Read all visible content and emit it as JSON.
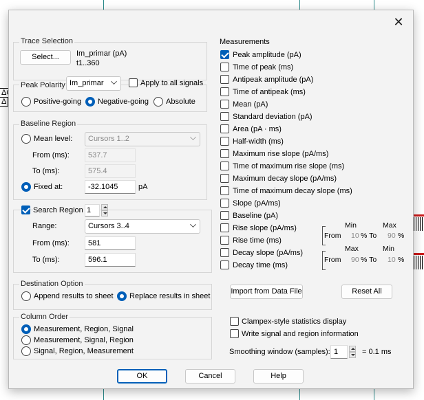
{
  "background": {
    "frag1": "ΔC",
    "frag2": "Δ"
  },
  "dialog": {
    "close_glyph": "✕",
    "trace_selection": {
      "title": "Trace Selection",
      "select_button": "Select...",
      "signal_name": "Im_primar (pA)",
      "trace_range": "t1..360"
    },
    "peak_polarity": {
      "title": "Peak Polarity",
      "signal_value": "Im_primar",
      "apply_all_label": "Apply to all signals",
      "apply_all_checked": false,
      "options": [
        "Positive-going",
        "Negative-going",
        "Absolute"
      ],
      "selected": "Negative-going"
    },
    "baseline_region": {
      "title": "Baseline Region",
      "mean_level_label": "Mean level:",
      "mean_level_value": "Cursors 1..2",
      "from_label": "From (ms):",
      "from_value": "537.7",
      "to_label": "To (ms):",
      "to_value": "575.4",
      "fixed_at_label": "Fixed at:",
      "fixed_at_value": "-32.1045",
      "fixed_unit": "pA",
      "selected": "Fixed at"
    },
    "search_region": {
      "label": "Search Region",
      "checked": true,
      "region_number": "1",
      "range_label": "Range:",
      "range_value": "Cursors 3..4",
      "from_label": "From (ms):",
      "from_value": "581",
      "to_label": "To (ms):",
      "to_value": "596.1"
    },
    "measurements": {
      "title": "Measurements",
      "items": [
        {
          "label": "Peak amplitude (pA)",
          "checked": true
        },
        {
          "label": "Time of peak (ms)",
          "checked": false
        },
        {
          "label": "Antipeak amplitude (pA)",
          "checked": false
        },
        {
          "label": "Time of antipeak (ms)",
          "checked": false
        },
        {
          "label": "Mean (pA)",
          "checked": false
        },
        {
          "label": "Standard deviation (pA)",
          "checked": false
        },
        {
          "label": "Area (pA · ms)",
          "checked": false
        },
        {
          "label": "Half-width (ms)",
          "checked": false
        },
        {
          "label": "Maximum rise slope (pA/ms)",
          "checked": false
        },
        {
          "label": "Time of maximum rise slope (ms)",
          "checked": false
        },
        {
          "label": "Maximum decay slope (pA/ms)",
          "checked": false
        },
        {
          "label": "Time of maximum decay slope (ms)",
          "checked": false
        },
        {
          "label": "Slope (pA/ms)",
          "checked": false
        },
        {
          "label": "Baseline (pA)",
          "checked": false
        },
        {
          "label": "Rise slope (pA/ms)",
          "checked": false
        },
        {
          "label": "Rise time (ms)",
          "checked": false
        },
        {
          "label": "Decay slope (pA/ms)",
          "checked": false
        },
        {
          "label": "Decay time (ms)",
          "checked": false
        }
      ],
      "rise": {
        "min_label": "Min",
        "max_label": "Max",
        "from_label": "From",
        "from_value": "10",
        "to_label": "% To",
        "to_value": "90",
        "pct": "%"
      },
      "decay": {
        "max_label": "Max",
        "min_label": "Min",
        "from_label": "From",
        "from_value": "90",
        "to_label": "% To",
        "to_value": "10",
        "pct": "%"
      }
    },
    "destination": {
      "title": "Destination Option",
      "options": [
        "Append results to sheet",
        "Replace results in sheet"
      ],
      "selected": "Replace results in sheet"
    },
    "import_button": "Import from Data File",
    "reset_button": "Reset All",
    "column_order": {
      "title": "Column Order",
      "options": [
        "Measurement, Region, Signal",
        "Measurement, Signal, Region",
        "Signal, Region, Measurement"
      ],
      "selected": "Measurement, Region, Signal"
    },
    "clampex_label": "Clampex-style statistics display",
    "write_signal_label": "Write signal and region information",
    "smoothing_label": "Smoothing window (samples):",
    "smoothing_value": "1",
    "smoothing_result": "= 0.1 ms",
    "ok_button": "OK",
    "cancel_button": "Cancel",
    "help_button": "Help"
  }
}
